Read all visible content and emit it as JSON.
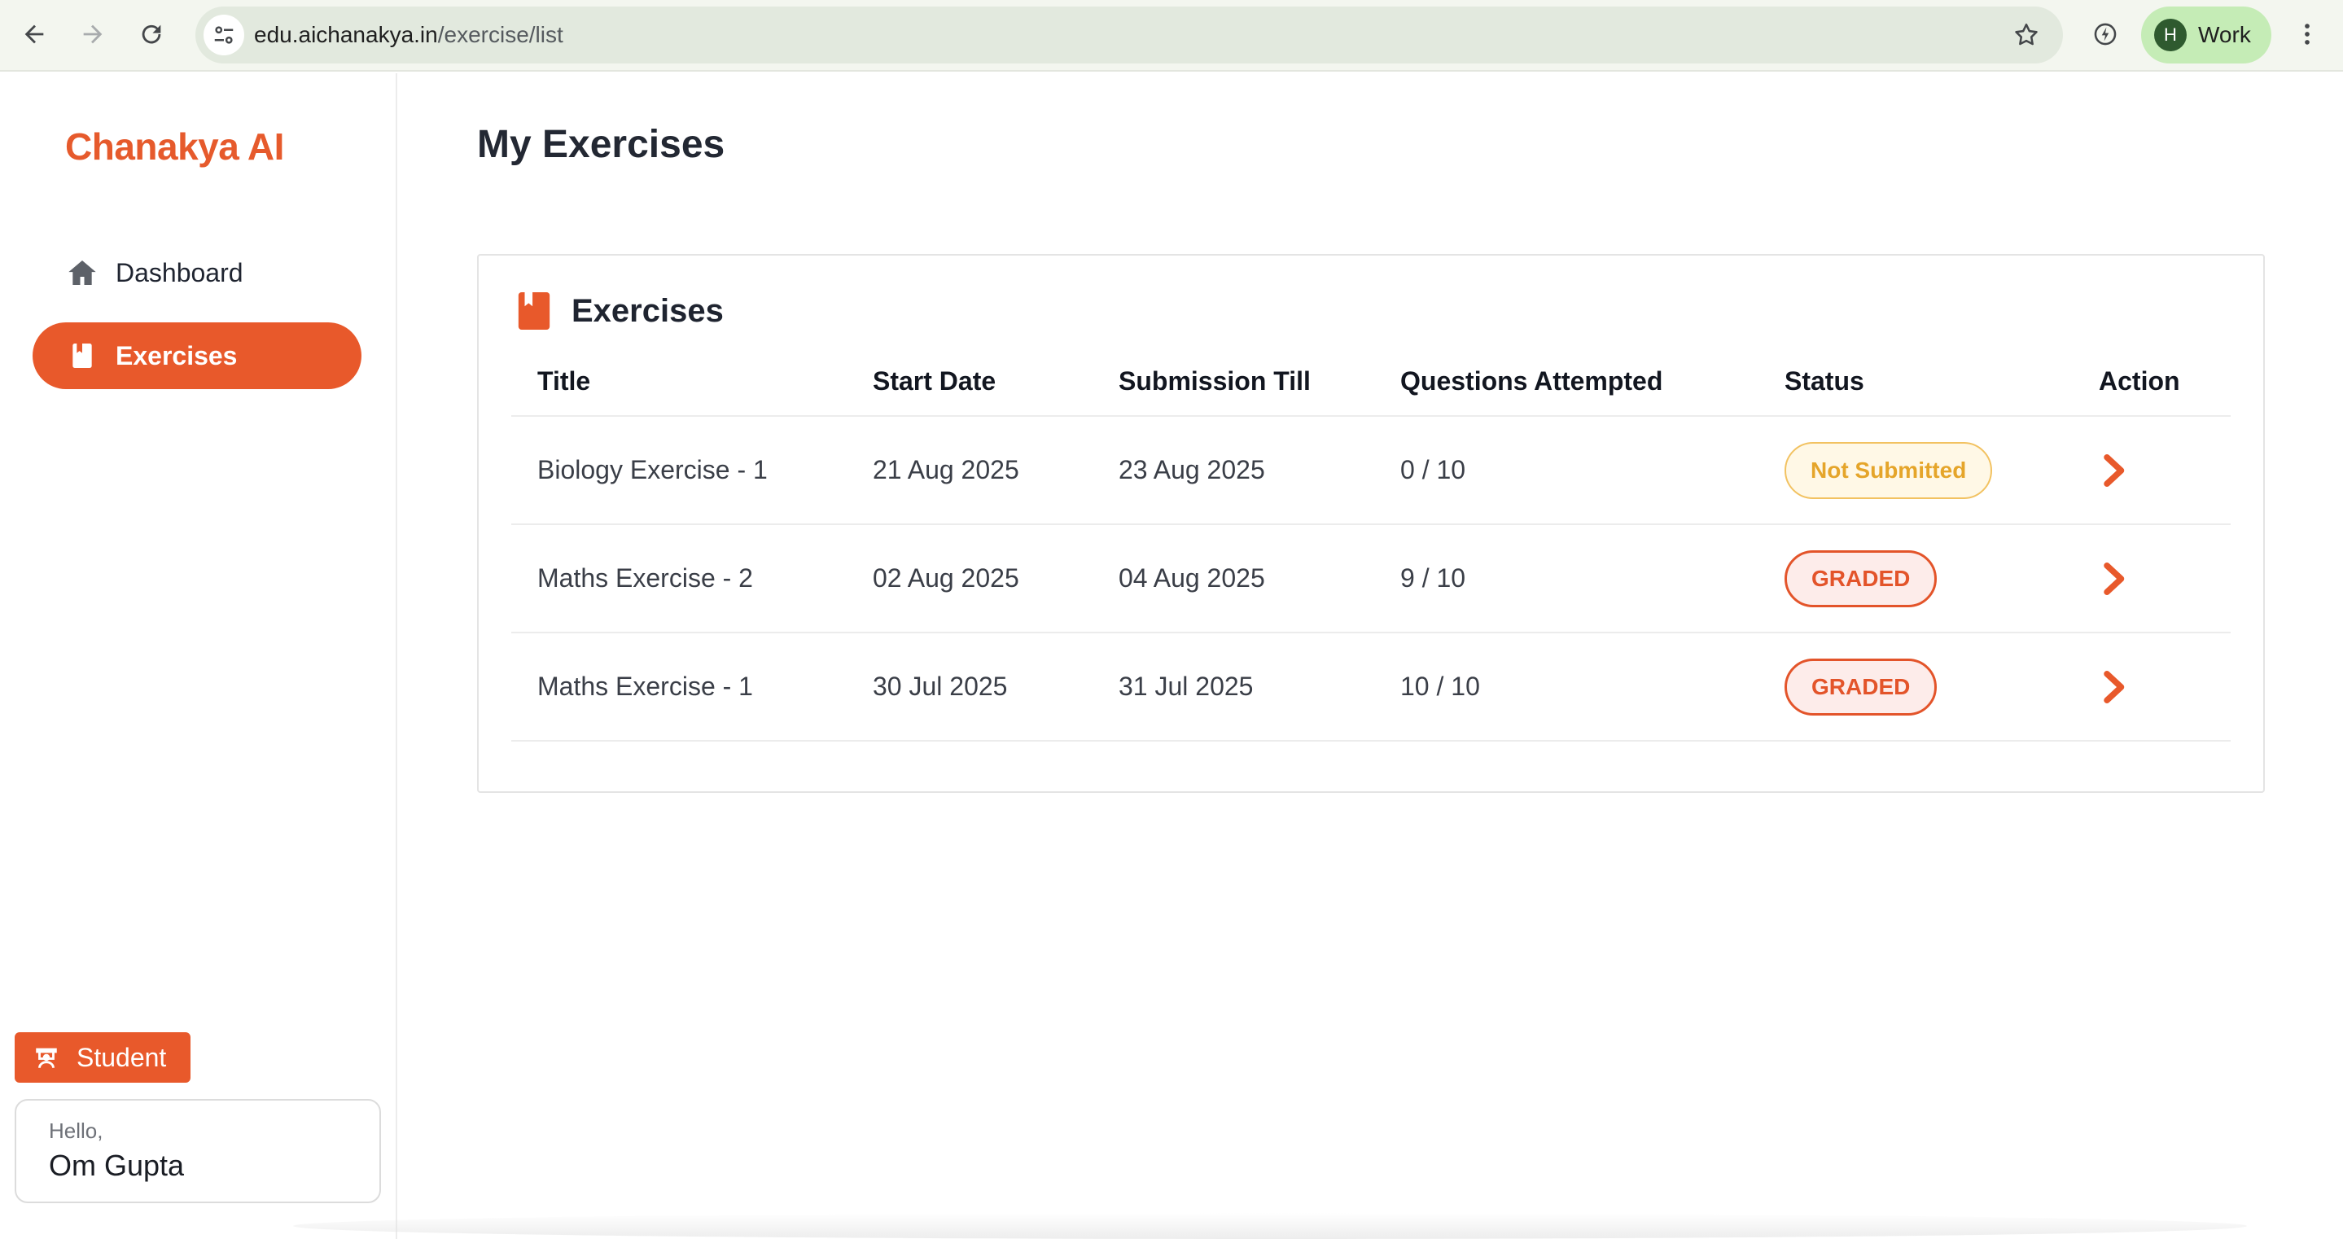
{
  "browser": {
    "url_host": "edu.aichanakya.in",
    "url_path": "/exercise/list",
    "profile_initial": "H",
    "profile_name": "Work"
  },
  "sidebar": {
    "logo": "Chanakya AI",
    "items": [
      {
        "label": "Dashboard",
        "icon": "home-icon",
        "active": false
      },
      {
        "label": "Exercises",
        "icon": "book-icon",
        "active": true
      }
    ],
    "role": "Student",
    "greeting": "Hello,",
    "user_name": "Om Gupta"
  },
  "main": {
    "title": "My Exercises",
    "card_title": "Exercises",
    "columns": [
      "Title",
      "Start Date",
      "Submission Till",
      "Questions Attempted",
      "Status",
      "Action"
    ],
    "rows": [
      {
        "title": "Biology Exercise - 1",
        "start": "21 Aug 2025",
        "due": "23 Aug 2025",
        "attempted": "0 / 10",
        "status": "Not Submitted",
        "status_kind": "pending"
      },
      {
        "title": "Maths Exercise - 2",
        "start": "02 Aug 2025",
        "due": "04 Aug 2025",
        "attempted": "9 / 10",
        "status": "GRADED",
        "status_kind": "graded"
      },
      {
        "title": "Maths Exercise - 1",
        "start": "30 Jul 2025",
        "due": "31 Jul 2025",
        "attempted": "10 / 10",
        "status": "GRADED",
        "status_kind": "graded"
      }
    ]
  },
  "colors": {
    "accent": "#e8592b",
    "pending_text": "#e5a52a",
    "graded_text": "#e3542a"
  }
}
